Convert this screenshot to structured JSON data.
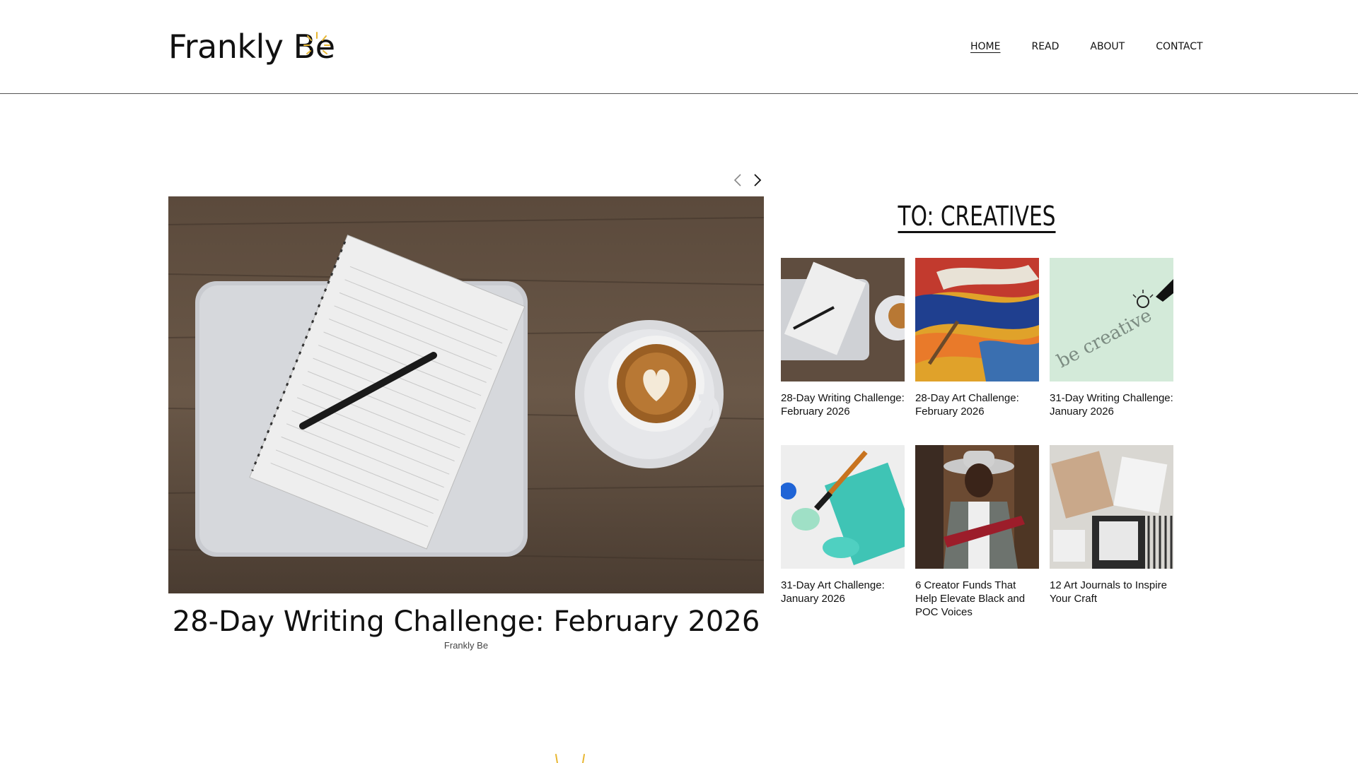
{
  "site": {
    "logo_text": "Frankly Be",
    "accent_color": "#E8B732"
  },
  "nav": {
    "items": [
      {
        "label": "HOME",
        "active": true
      },
      {
        "label": "READ",
        "active": false
      },
      {
        "label": "ABOUT",
        "active": false
      },
      {
        "label": "CONTACT",
        "active": false
      }
    ]
  },
  "slider": {
    "prev_icon": "chevron-left-icon",
    "next_icon": "chevron-right-icon",
    "featured": {
      "title": "28-Day Writing Challenge: February 2026",
      "author": "Frankly Be"
    }
  },
  "creatives": {
    "heading": "TO: CREATIVES",
    "posts": [
      {
        "title": "28-Day Writing Challenge: February 2026"
      },
      {
        "title": "28-Day Art Challenge: February 2026"
      },
      {
        "title": "31-Day Writing Challenge: January 2026"
      },
      {
        "title": "31-Day Art Challenge: January 2026"
      },
      {
        "title": "6 Creator Funds That Help Elevate Black and POC Voices"
      },
      {
        "title": "12 Art Journals to Inspire Your Craft"
      }
    ]
  }
}
